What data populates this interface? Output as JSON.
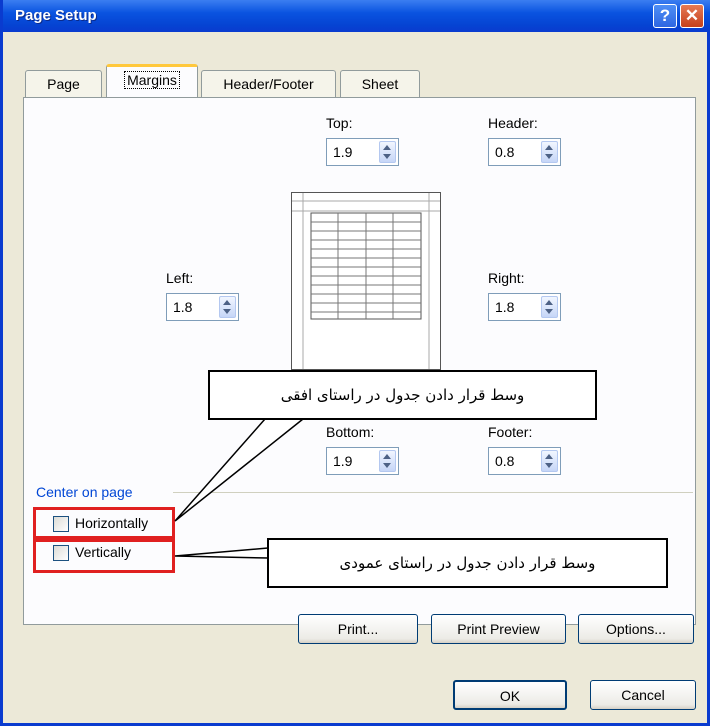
{
  "window": {
    "title": "Page Setup"
  },
  "titlebar": {
    "help_glyph": "?",
    "close_glyph": "✕"
  },
  "tabs": [
    {
      "label": "Page"
    },
    {
      "label": "Margins",
      "active": true
    },
    {
      "label": "Header/Footer"
    },
    {
      "label": "Sheet"
    }
  ],
  "margins": {
    "top": {
      "label": "Top:",
      "value": "1.9"
    },
    "header": {
      "label": "Header:",
      "value": "0.8"
    },
    "left": {
      "label": "Left:",
      "value": "1.8"
    },
    "right": {
      "label": "Right:",
      "value": "1.8"
    },
    "bottom": {
      "label": "Bottom:",
      "value": "1.9"
    },
    "footer": {
      "label": "Footer:",
      "value": "0.8"
    }
  },
  "center_on_page": {
    "title": "Center on page",
    "horizontally": {
      "label": "Horizontally",
      "checked": false
    },
    "vertically": {
      "label": "Vertically",
      "checked": false
    }
  },
  "buttons": {
    "print": "Print...",
    "print_preview": "Print Preview",
    "options": "Options...",
    "ok": "OK",
    "cancel": "Cancel"
  },
  "callouts": {
    "horizontal_note": "وسط قرار دادن جدول در راستای افقی",
    "vertical_note": "وسط قرار دادن جدول در راستای عمودی"
  },
  "colors": {
    "titlebar": "#0a53e0",
    "highlight": "#e02020",
    "group_title": "#0046d5"
  },
  "icons": [
    "help-icon",
    "close-icon",
    "spin-up-icon",
    "spin-down-icon",
    "checkbox-icon"
  ]
}
